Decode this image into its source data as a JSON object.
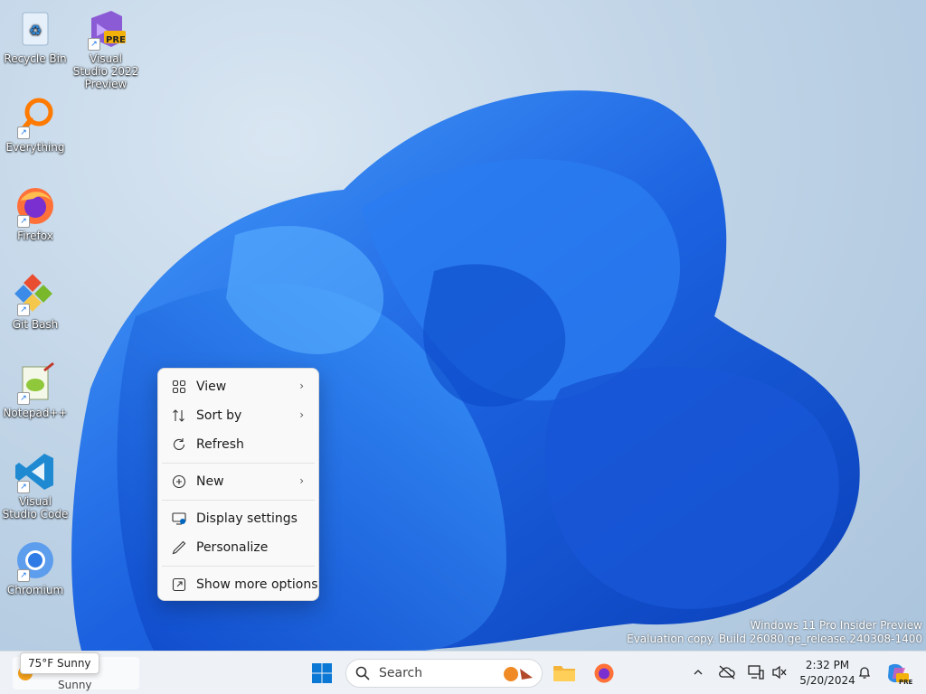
{
  "desktop": {
    "icons": [
      {
        "label": "Recycle Bin"
      },
      {
        "label": "Visual Studio 2022 Preview",
        "badge": "PRE"
      },
      {
        "label": "Everything"
      },
      {
        "label": "Firefox"
      },
      {
        "label": "Git Bash"
      },
      {
        "label": "Notepad++"
      },
      {
        "label": "Visual Studio Code"
      },
      {
        "label": "Chromium"
      }
    ]
  },
  "context_menu": {
    "items": [
      {
        "label": "View",
        "icon": "view-grid-icon",
        "submenu": true
      },
      {
        "label": "Sort by",
        "icon": "sort-arrows-icon",
        "submenu": true
      },
      {
        "label": "Refresh",
        "icon": "refresh-icon",
        "submenu": false
      },
      {
        "label": "New",
        "icon": "plus-circle-icon",
        "submenu": true
      },
      {
        "label": "Display settings",
        "icon": "display-settings-icon",
        "submenu": false
      },
      {
        "label": "Personalize",
        "icon": "pen-icon",
        "submenu": false
      },
      {
        "label": "Show more options",
        "icon": "share-box-icon",
        "submenu": false
      }
    ]
  },
  "watermark": {
    "line1": "Windows 11 Pro Insider Preview",
    "line2": "Evaluation copy. Build 26080.ge_release.240308-1400"
  },
  "taskbar": {
    "weather_tooltip": "75°F Sunny",
    "weather_sub": "Sunny",
    "search_placeholder": "Search",
    "clock_time": "2:32 PM",
    "clock_date": "5/20/2024",
    "copilot_badge": "PRE"
  },
  "colors": {
    "accent": "#0067c0",
    "bloom": "#1e6fe0"
  }
}
